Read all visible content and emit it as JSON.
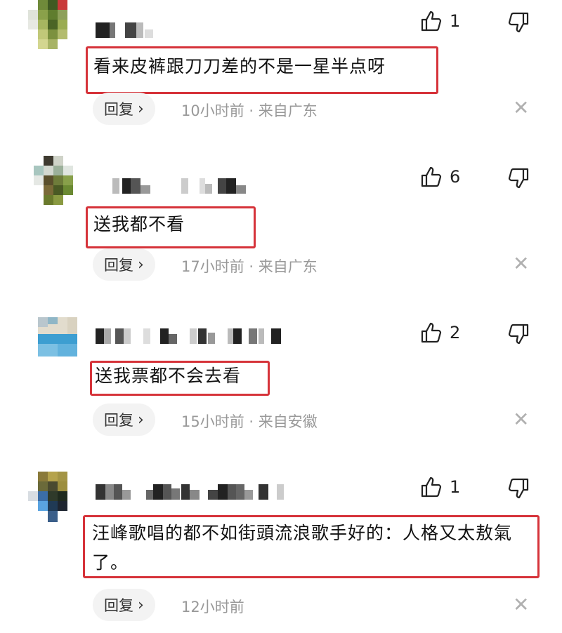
{
  "comments": [
    {
      "text": "看来皮裤跟刀刀差的不是一星半点呀",
      "likes": "1",
      "reply_label": "回复",
      "meta": "10小时前 · 来自广东"
    },
    {
      "text": "送我都不看",
      "likes": "6",
      "reply_label": "回复",
      "meta": "17小时前 · 来自广东"
    },
    {
      "text": "送我票都不会去看",
      "likes": "2",
      "reply_label": "回复",
      "meta": "15小时前 · 来自安徽"
    },
    {
      "text": "汪峰歌唱的都不如街頭流浪歌手好的：人格又太敖氣了。",
      "likes": "1",
      "reply_label": "回复",
      "meta": "12小时前"
    }
  ],
  "icons": {
    "like": "thumbs-up-icon",
    "dislike": "thumbs-down-icon",
    "close": "close-icon",
    "chevron": "chevron-right-icon"
  },
  "colors": {
    "highlight_border": "#d6333a",
    "meta_text": "#999999",
    "reply_bg": "#f3f3f3"
  }
}
